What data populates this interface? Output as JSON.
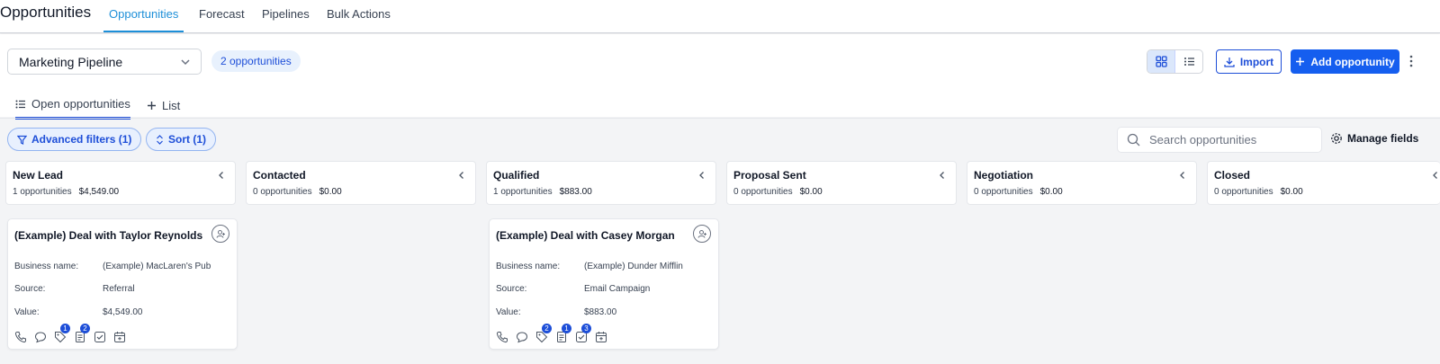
{
  "header": {
    "app_title": "Opportunities",
    "tabs": [
      {
        "label": "Opportunities",
        "active": true
      },
      {
        "label": "Forecast"
      },
      {
        "label": "Pipelines"
      },
      {
        "label": "Bulk Actions"
      }
    ]
  },
  "toolbar": {
    "pipeline": "Marketing Pipeline",
    "count": "2 opportunities",
    "import_label": "Import",
    "add_label": "Add opportunity"
  },
  "subtabs": {
    "open": "Open opportunities",
    "list": "List"
  },
  "filters": {
    "advanced": "Advanced filters (1)",
    "sort": "Sort (1)",
    "search_placeholder": "Search opportunities",
    "manage_fields": "Manage fields"
  },
  "columns": [
    {
      "name": "New Lead",
      "count": "1 opportunities",
      "total": "$4,549.00"
    },
    {
      "name": "Contacted",
      "count": "0 opportunities",
      "total": "$0.00"
    },
    {
      "name": "Qualified",
      "count": "1 opportunities",
      "total": "$883.00"
    },
    {
      "name": "Proposal Sent",
      "count": "0 opportunities",
      "total": "$0.00"
    },
    {
      "name": "Negotiation",
      "count": "0 opportunities",
      "total": "$0.00"
    },
    {
      "name": "Closed",
      "count": "0 opportunities",
      "total": "$0.00"
    }
  ],
  "cards": [
    {
      "title": "(Example) Deal with Taylor Reynolds",
      "business_label": "Business name:",
      "business": "(Example) MacLaren's Pub",
      "source_label": "Source:",
      "source": "Referral",
      "value_label": "Value:",
      "value": "$4,549.00",
      "badges": {
        "tag": "1",
        "notes": "2"
      }
    },
    {
      "title": "(Example) Deal with Casey Morgan",
      "business_label": "Business name:",
      "business": "(Example) Dunder Mifflin",
      "source_label": "Source:",
      "source": "Email Campaign",
      "value_label": "Value:",
      "value": "$883.00",
      "badges": {
        "tag": "2",
        "notes": "1",
        "tasks": "3"
      }
    }
  ],
  "colors": {
    "primary": "#155eef",
    "active_tab": "#1d8fd8",
    "badge": "#1d4ed8"
  }
}
